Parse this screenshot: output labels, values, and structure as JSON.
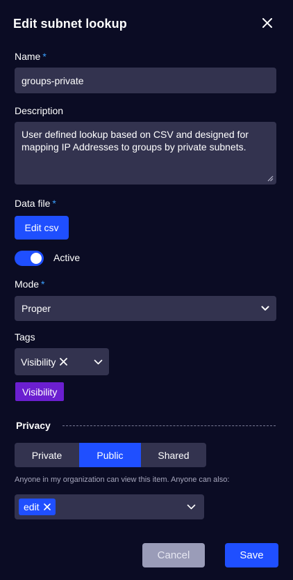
{
  "title": "Edit subnet lookup",
  "name": {
    "label": "Name",
    "required_mark": "*",
    "value": "groups-private"
  },
  "description": {
    "label": "Description",
    "value": "User defined lookup based on CSV and designed for mapping IP Addresses to groups by private subnets."
  },
  "data_file": {
    "label": "Data file",
    "required_mark": "*",
    "button": "Edit csv"
  },
  "active": {
    "label": "Active",
    "on": true
  },
  "mode": {
    "label": "Mode",
    "required_mark": "*",
    "value": "Proper"
  },
  "tags": {
    "label": "Tags",
    "selected": "Visibility",
    "badge": "Visibility"
  },
  "privacy": {
    "label": "Privacy",
    "options": [
      "Private",
      "Public",
      "Shared"
    ],
    "selected": "Public",
    "help": "Anyone in my organization can view this item. Anyone can also:",
    "permission_chip": "edit"
  },
  "footer": {
    "cancel": "Cancel",
    "save": "Save"
  },
  "colors": {
    "background": "#0b0c24",
    "field": "#33334f",
    "accent": "#1f4fff",
    "badge": "#6b1fd0",
    "required": "#3aa0ff"
  }
}
